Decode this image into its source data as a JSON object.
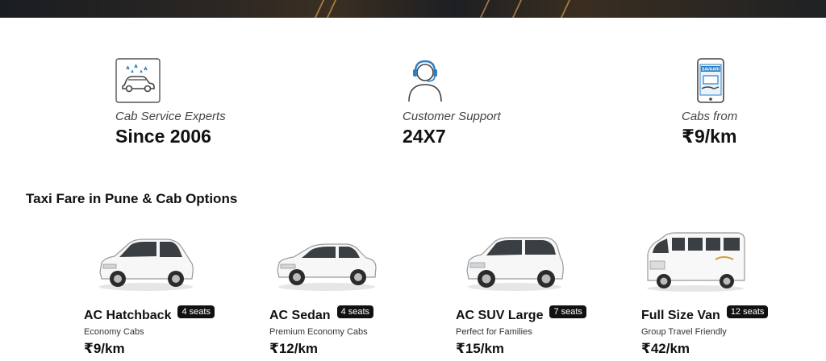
{
  "features": [
    {
      "icon": "car-wash-icon",
      "label": "Cab Service Experts",
      "value": "Since 2006"
    },
    {
      "icon": "headset-support-icon",
      "label": "Customer Support",
      "value": "24X7"
    },
    {
      "icon": "mobile-payment-icon",
      "label": "Cabs from",
      "value": "₹9/km",
      "icon_text": "SAVAARI"
    }
  ],
  "section_title": "Taxi Fare in Pune & Cab Options",
  "cabs": [
    {
      "image": "hatchback-car-image",
      "name": "AC Hatchback",
      "seats": "4 seats",
      "subtitle": "Economy Cabs",
      "price": "₹9/km"
    },
    {
      "image": "sedan-car-image",
      "name": "AC Sedan",
      "seats": "4 seats",
      "subtitle": "Premium Economy Cabs",
      "price": "₹12/km"
    },
    {
      "image": "suv-car-image",
      "name": "AC SUV Large",
      "seats": "7 seats",
      "subtitle": "Perfect for Families",
      "price": "₹15/km"
    },
    {
      "image": "van-image",
      "name": "Full Size Van",
      "seats": "12 seats",
      "subtitle": "Group Travel Friendly",
      "price": "₹42/km"
    }
  ],
  "colors": {
    "text": "#111111",
    "muted": "#444444",
    "badge_bg": "#111111",
    "icon_blue": "#2f7fc1"
  }
}
